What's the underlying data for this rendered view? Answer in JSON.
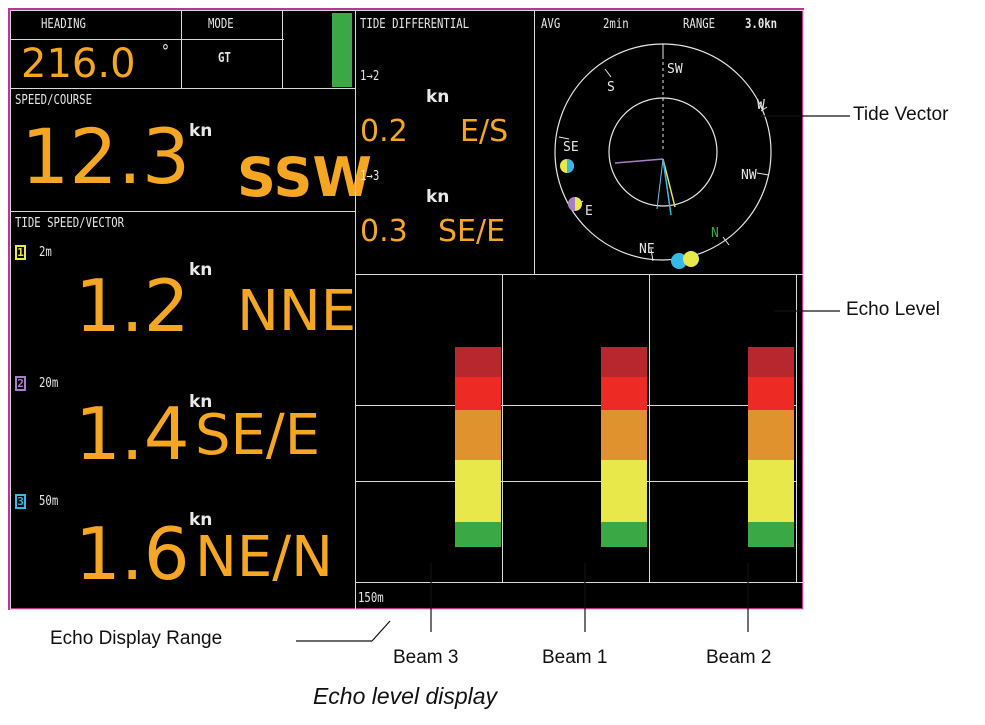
{
  "heading": {
    "label": "HEADING",
    "value": "216.0",
    "unit": "°"
  },
  "mode": {
    "label": "MODE",
    "value": "GT"
  },
  "speed_course": {
    "label": "SPEED/COURSE",
    "value": "12.3",
    "unit": "kn",
    "direction": "SSW"
  },
  "tide_speed_vector": {
    "label": "TIDE SPEED/VECTOR",
    "layers": [
      {
        "index": "1",
        "depth": "2m",
        "value": "1.2",
        "unit": "kn",
        "direction": "NNE",
        "color": "#e8e84a"
      },
      {
        "index": "2",
        "depth": "20m",
        "value": "1.4",
        "unit": "kn",
        "direction": "SE/E",
        "color": "#a77fc9"
      },
      {
        "index": "3",
        "depth": "50m",
        "value": "1.6",
        "unit": "kn",
        "direction": "NE/N",
        "color": "#38b8e6"
      }
    ]
  },
  "tide_differential": {
    "label": "TIDE DIFFERENTIAL",
    "rows": [
      {
        "pair": "1→2",
        "unit": "kn",
        "value": "0.2",
        "direction": "E/S"
      },
      {
        "pair": "1→3",
        "unit": "kn",
        "value": "0.3",
        "direction": "SE/E"
      }
    ]
  },
  "tide_vector": {
    "avg_label": "AVG",
    "avg_value": "2min",
    "range_label": "RANGE",
    "range_value": "3.0kn",
    "compass": {
      "sw": "SW",
      "s": "S",
      "w": "W",
      "se": "SE",
      "nw": "NW",
      "e": "E",
      "ne": "NE",
      "n": "N"
    }
  },
  "echo": {
    "range": "150m",
    "segment_colors": [
      "#b8262e",
      "#ee2a24",
      "#e0922e",
      "#e8e84a",
      "#3aa844"
    ]
  },
  "callouts": {
    "tide_vector": "Tide Vector",
    "echo_level": "Echo Level",
    "echo_display_range": "Echo Display Range",
    "beam3": "Beam 3",
    "beam1": "Beam 1",
    "beam2": "Beam 2"
  },
  "caption": "Echo level display"
}
